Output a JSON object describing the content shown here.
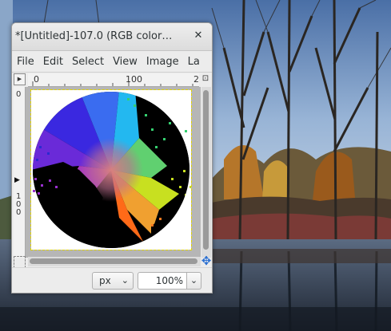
{
  "window": {
    "title": "*[Untitled]-107.0 (RGB color",
    "title_ellipsis": "…",
    "close_icon": "✕"
  },
  "menubar": {
    "items": [
      "File",
      "Edit",
      "Select",
      "View",
      "Image",
      "La"
    ]
  },
  "rulers": {
    "horizontal_labels": [
      "0",
      "100",
      "2"
    ],
    "vertical_labels": [
      "0",
      "1",
      "0",
      "0"
    ]
  },
  "statusbar": {
    "unit": "px",
    "zoom": "100%"
  },
  "icons": {
    "corner": "ruler-corner-icon",
    "navigate": "navigate-icon",
    "chevron": "chevron-down-icon"
  },
  "colors": {
    "canvas_background": "#ffffff",
    "image_disc": "#000000",
    "selection_outline": "#e0d400",
    "navigate_icon": "#2a6fd1"
  }
}
